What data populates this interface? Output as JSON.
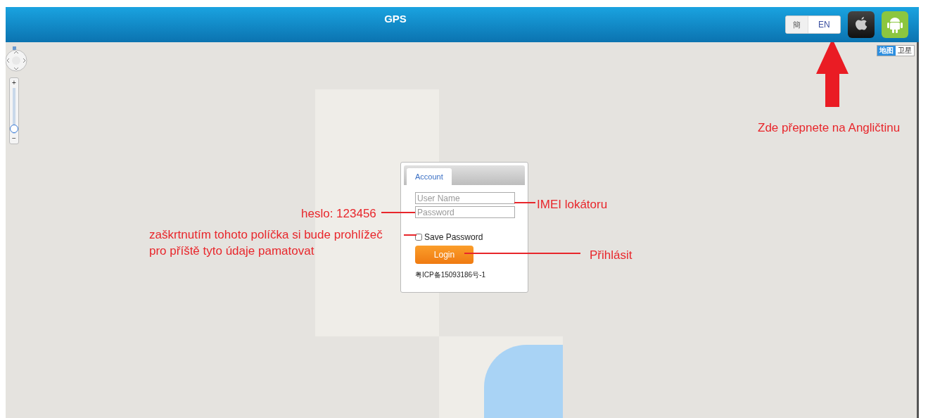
{
  "header": {
    "title": "GPS"
  },
  "language_switch": [
    {
      "label": "簡",
      "selected": false
    },
    {
      "label": "EN",
      "selected": true
    }
  ],
  "zoom_control": {
    "zoom_in": "+",
    "zoom_out": "−",
    "level": 0.2
  },
  "map_type": [
    {
      "label": "地图",
      "selected": true
    },
    {
      "label": "卫星",
      "selected": false
    }
  ],
  "login": {
    "tabs": [
      {
        "label": "Account",
        "selected": true
      }
    ],
    "username": {
      "placeholder": "User Name"
    },
    "password": {
      "placeholder": "Password"
    },
    "save_password": {
      "label": "Save Password",
      "checked": false
    },
    "login_button": "Login",
    "icp": "粤ICP备15093186号-1"
  },
  "annotations": [
    {
      "kind": "arrow",
      "text": "Zde přepnete na Angličtinu"
    },
    {
      "kind": "callout",
      "text": "IMEI lokátoru"
    },
    {
      "kind": "callout",
      "text": "heslo: 123456"
    },
    {
      "kind": "callout",
      "text": "zaškrtnutím tohoto políčka si bude prohlížeč pro příště tyto údaje pamatovat"
    },
    {
      "kind": "callout",
      "text": "Přihlásit"
    }
  ]
}
